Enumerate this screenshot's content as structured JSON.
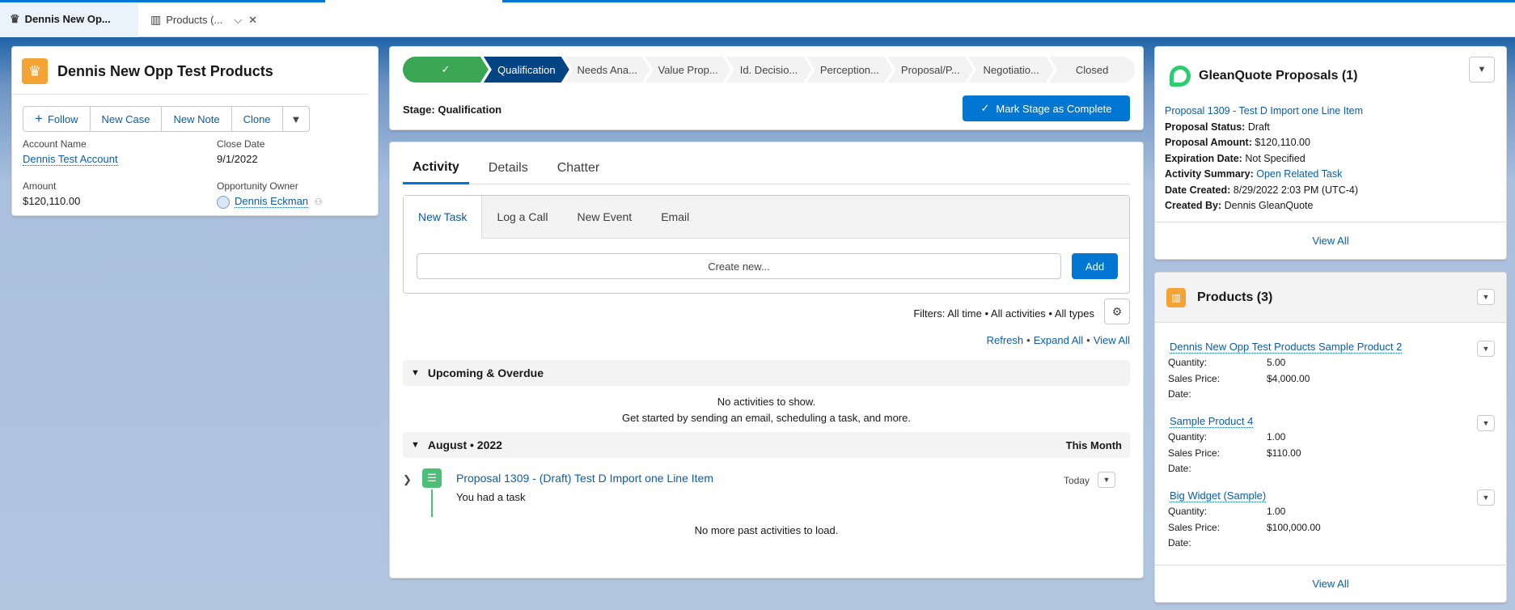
{
  "tabs": [
    {
      "label": "Dennis New Op...",
      "icon": "crown-icon"
    },
    {
      "label": "Products (...",
      "icon": "barcode-icon"
    }
  ],
  "header": {
    "title": "Dennis New Opp Test Products",
    "buttons": {
      "follow": "Follow",
      "new_case": "New Case",
      "new_note": "New Note",
      "clone": "Clone"
    },
    "fields": {
      "account_name_label": "Account Name",
      "account_name": "Dennis Test Account",
      "close_date_label": "Close Date",
      "close_date": "9/1/2022",
      "amount_label": "Amount",
      "amount": "$120,110.00",
      "owner_label": "Opportunity Owner",
      "owner": "Dennis Eckman"
    }
  },
  "path": {
    "stages": [
      "",
      "Qualification",
      "Needs Ana...",
      "Value Prop...",
      "Id. Decisio...",
      "Perception...",
      "Proposal/P...",
      "Negotiatio...",
      "Closed"
    ],
    "stage_label": "Stage: Qualification",
    "mark_complete": "Mark Stage as Complete"
  },
  "activity": {
    "tabs": [
      "Activity",
      "Details",
      "Chatter"
    ],
    "composer_tabs": [
      "New Task",
      "Log a Call",
      "New Event",
      "Email"
    ],
    "create_placeholder": "Create new...",
    "add": "Add",
    "filters": "Filters: All time • All activities • All types",
    "links": {
      "refresh": "Refresh",
      "expand_all": "Expand All",
      "view_all": "View All"
    },
    "upcoming": "Upcoming & Overdue",
    "no_activities": "No activities to show.",
    "get_started": "Get started by sending an email, scheduling a task, and more.",
    "month": "August • 2022",
    "this_month": "This Month",
    "task_title": "Proposal 1309 - (Draft) Test D Import one Line Item",
    "task_sub": "You had a task",
    "task_date": "Today",
    "no_more": "No more past activities to load."
  },
  "glean": {
    "title": "GleanQuote Proposals (1)",
    "proposal_link": "Proposal 1309 - Test D Import one Line Item",
    "status_label": "Proposal Status:",
    "status": "Draft",
    "amount_label": "Proposal Amount:",
    "amount": "$120,110.00",
    "expiration_label": "Expiration Date:",
    "expiration": "Not Specified",
    "activity_label": "Activity Summary:",
    "activity": "Open Related Task",
    "created_label": "Date Created:",
    "created": "8/29/2022 2:03 PM (UTC-4)",
    "createdby_label": "Created By:",
    "createdby": "Dennis GleanQuote",
    "view_all": "View All"
  },
  "products": {
    "title": "Products (3)",
    "items": [
      {
        "name": "Dennis New Opp Test Products Sample Product 2",
        "quantity": "5.00",
        "price": "$4,000.00"
      },
      {
        "name": "Sample Product 4",
        "quantity": "1.00",
        "price": "$110.00"
      },
      {
        "name": "Big Widget (Sample)",
        "quantity": "1.00",
        "price": "$100,000.00"
      }
    ],
    "labels": {
      "quantity": "Quantity:",
      "price": "Sales Price:",
      "date": "Date:"
    },
    "view_all": "View All"
  },
  "colors": {
    "brand": "#0176d3",
    "stage_complete": "#3ba755",
    "stage_current": "#014486",
    "crown": "#f4a434"
  }
}
